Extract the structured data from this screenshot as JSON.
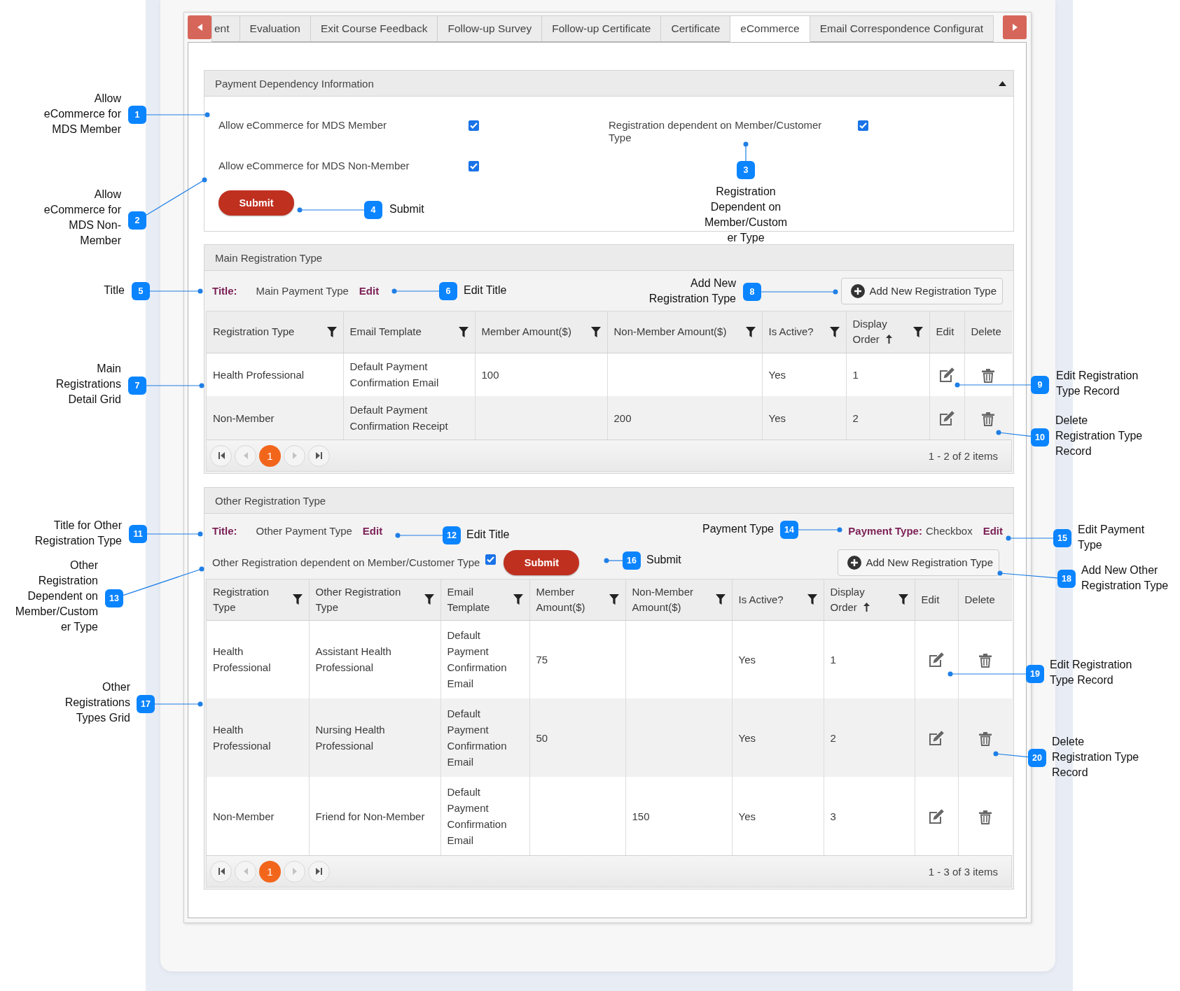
{
  "tabs": {
    "items": [
      {
        "label": "ent",
        "selected": false
      },
      {
        "label": "Evaluation",
        "selected": false
      },
      {
        "label": "Exit Course Feedback",
        "selected": false
      },
      {
        "label": "Follow-up Survey",
        "selected": false
      },
      {
        "label": "Follow-up Certificate",
        "selected": false
      },
      {
        "label": "Certificate",
        "selected": false
      },
      {
        "label": "eCommerce",
        "selected": true
      },
      {
        "label": "Email Correspondence Configurat",
        "selected": false
      }
    ]
  },
  "payment_dependency": {
    "title": "Payment Dependency Information",
    "expanded": true,
    "options": [
      {
        "label": "Allow eCommerce for MDS Member",
        "checked": true
      },
      {
        "label": "Registration dependent on Member/Customer Type",
        "checked": true
      },
      {
        "label": "Allow eCommerce for MDS Non-Member",
        "checked": true
      }
    ],
    "submit": "Submit"
  },
  "main_registration": {
    "title": "Main Registration Type",
    "title_label": "Title:",
    "title_value": "Main Payment Type",
    "edit_link": "Edit",
    "add_button": "Add New Registration Type",
    "grid": {
      "columns": [
        {
          "label": "Registration Type",
          "kind": "text",
          "filter": true
        },
        {
          "label": "Email Template",
          "kind": "text",
          "filter": true
        },
        {
          "label": "Member Amount($)",
          "kind": "text",
          "filter": true
        },
        {
          "label": "Non-Member Amount($)",
          "kind": "text",
          "filter": true
        },
        {
          "label": "Is Active?",
          "kind": "text",
          "filter": true
        },
        {
          "label": "Display Order",
          "kind": "text",
          "filter": true,
          "sorted_ascending": true
        },
        {
          "label": "Edit",
          "kind": "edit",
          "filter": false
        },
        {
          "label": "Delete",
          "kind": "delete",
          "filter": false
        }
      ],
      "rows": [
        {
          "cells": [
            "Health Professional",
            "Default Payment Confirmation Email",
            "100",
            null,
            "Yes",
            "1"
          ]
        },
        {
          "cells": [
            "Non-Member",
            "Default Payment Confirmation Receipt",
            null,
            "200",
            "Yes",
            "2"
          ]
        }
      ],
      "pager": {
        "nav": [
          {
            "kind": "first",
            "disabled": false
          },
          {
            "kind": "prev",
            "disabled": true
          },
          {
            "kind": "next",
            "disabled": true
          },
          {
            "kind": "last",
            "disabled": false
          }
        ],
        "pages": [
          {
            "label": "1",
            "selected": true
          }
        ],
        "summary": "1 - 2 of 2 items"
      }
    }
  },
  "other_registration": {
    "title": "Other Registration Type",
    "title_label": "Title:",
    "title_value": "Other Payment Type",
    "edit_link": "Edit",
    "payment_type": {
      "label": "Payment Type:",
      "value": "Checkbox",
      "edit_link": "Edit"
    },
    "dependent": {
      "label": "Other Registration dependent on Member/Customer Type",
      "checked": true
    },
    "submit": "Submit",
    "add_button": "Add New Registration Type",
    "grid": {
      "columns": [
        {
          "label": "Registration Type",
          "kind": "text",
          "filter": true
        },
        {
          "label": "Other Registration Type",
          "kind": "text",
          "filter": true
        },
        {
          "label": "Email Template",
          "kind": "text",
          "filter": true
        },
        {
          "label": "Member Amount($)",
          "kind": "text",
          "filter": true
        },
        {
          "label": "Non-Member Amount($)",
          "kind": "text",
          "filter": true
        },
        {
          "label": "Is Active?",
          "kind": "text",
          "filter": true
        },
        {
          "label": "Display Order",
          "kind": "text",
          "filter": true,
          "sorted_ascending": true
        },
        {
          "label": "Edit",
          "kind": "edit",
          "filter": false
        },
        {
          "label": "Delete",
          "kind": "delete",
          "filter": false
        }
      ],
      "rows": [
        {
          "cells": [
            "Health Professional",
            "Assistant Health Professional",
            "Default Payment Confirmation Email",
            "75",
            null,
            "Yes",
            "1"
          ]
        },
        {
          "cells": [
            "Health Professional",
            "Nursing Health Professional",
            "Default Payment Confirmation Email",
            "50",
            null,
            "Yes",
            "2"
          ]
        },
        {
          "cells": [
            "Non-Member",
            "Friend for Non-Member",
            "Default Payment Confirmation Email",
            null,
            "150",
            "Yes",
            "3"
          ]
        }
      ],
      "pager": {
        "nav": [
          {
            "kind": "first",
            "disabled": false
          },
          {
            "kind": "prev",
            "disabled": true
          },
          {
            "kind": "next",
            "disabled": true
          },
          {
            "kind": "last",
            "disabled": false
          }
        ],
        "pages": [
          {
            "label": "1",
            "selected": true
          }
        ],
        "summary": "1 - 3 of 3 items"
      }
    }
  },
  "callouts": [
    {
      "number": "1",
      "lines": [
        "Allow",
        "eCommerce for",
        "MDS Member"
      ]
    },
    {
      "number": "2",
      "lines": [
        "Allow",
        "eCommerce for",
        "MDS Non-",
        "Member"
      ]
    },
    {
      "number": "4",
      "lines": [
        "Submit"
      ]
    },
    {
      "number": "3",
      "lines": [
        "Registration",
        "Dependent on",
        "Member/Custom",
        "er Type"
      ]
    },
    {
      "number": "5",
      "lines": [
        "Title"
      ]
    },
    {
      "number": "6",
      "lines": [
        "Edit Title"
      ]
    },
    {
      "number": "8",
      "lines": [
        "Add New",
        "Registration Type"
      ]
    },
    {
      "number": "7",
      "lines": [
        "Main",
        "Registrations",
        "Detail Grid"
      ]
    },
    {
      "number": "9",
      "lines": [
        "Edit Registration",
        "Type Record"
      ]
    },
    {
      "number": "10",
      "lines": [
        "Delete",
        "Registration Type",
        "Record"
      ]
    },
    {
      "number": "11",
      "lines": [
        "Title for Other",
        "Registration Type"
      ]
    },
    {
      "number": "12",
      "lines": [
        "Edit Title"
      ]
    },
    {
      "number": "14",
      "lines": [
        "Payment Type"
      ]
    },
    {
      "number": "15",
      "lines": [
        "Edit Payment",
        "Type"
      ]
    },
    {
      "number": "13",
      "lines": [
        "Other",
        "Registration",
        "Dependent on",
        "Member/Custom",
        "er Type"
      ]
    },
    {
      "number": "16",
      "lines": [
        "Submit"
      ]
    },
    {
      "number": "18",
      "lines": [
        "Add New Other",
        "Registration Type"
      ]
    },
    {
      "number": "19",
      "lines": [
        "Edit Registration",
        "Type Record"
      ]
    },
    {
      "number": "17",
      "lines": [
        "Other",
        "Registrations",
        "Types Grid"
      ]
    },
    {
      "number": "20",
      "lines": [
        "Delete",
        "Registration Type",
        "Record"
      ]
    }
  ]
}
